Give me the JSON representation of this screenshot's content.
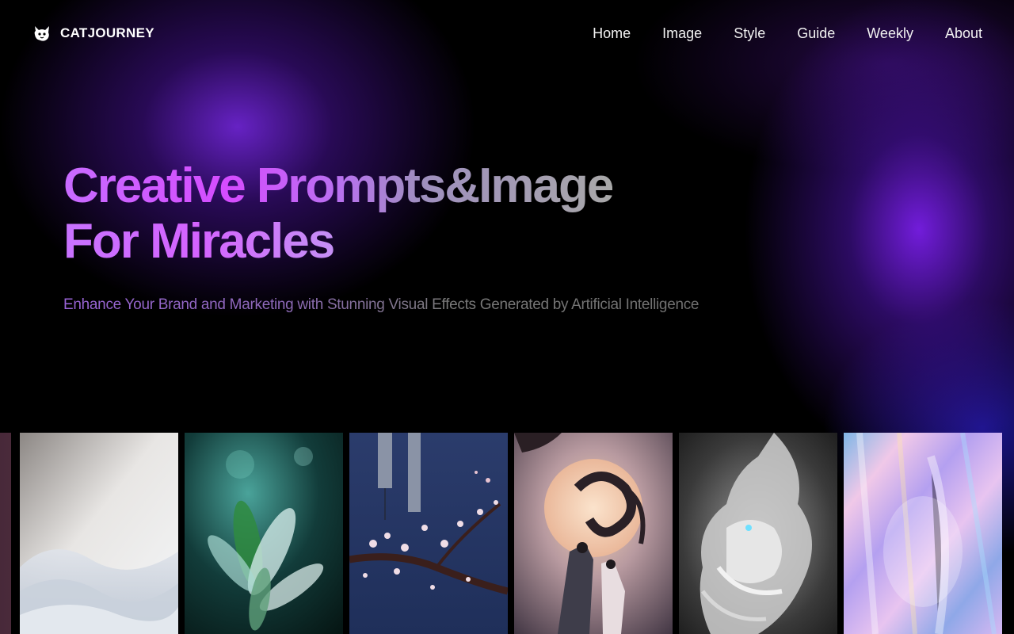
{
  "brand": {
    "name": "CATJOURNEY",
    "icon": "cat-logo-icon"
  },
  "nav": {
    "items": [
      {
        "label": "Home"
      },
      {
        "label": "Image"
      },
      {
        "label": "Style"
      },
      {
        "label": "Guide"
      },
      {
        "label": "Weekly"
      },
      {
        "label": "About"
      }
    ]
  },
  "hero": {
    "title_line1": "Creative Prompts&Image",
    "title_line2": "For Miracles",
    "subtitle": "Enhance Your Brand and Marketing with Stunning Visual Effects Generated by Artificial Intelligence"
  },
  "gallery": {
    "items": [
      {
        "name": "gallery-item-partial"
      },
      {
        "name": "gallery-item-white-waves"
      },
      {
        "name": "gallery-item-crystal-plant"
      },
      {
        "name": "gallery-item-cherry-blossom"
      },
      {
        "name": "gallery-item-moon-dragon"
      },
      {
        "name": "gallery-item-white-dragon"
      },
      {
        "name": "gallery-item-iridescent"
      }
    ]
  },
  "colors": {
    "accent_purple": "#d54cff",
    "glow_purple": "#7828e6",
    "background": "#000000"
  }
}
